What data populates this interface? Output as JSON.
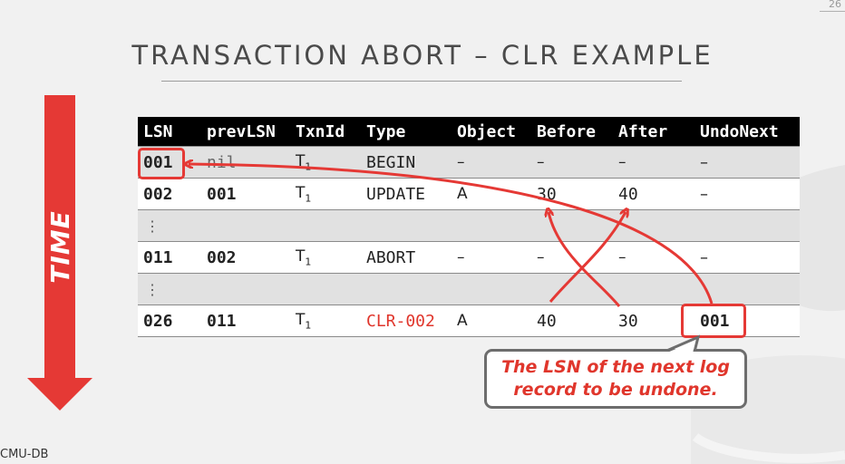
{
  "slide": {
    "number": "26",
    "title": "TRANSACTION ABORT – CLR EXAMPLE",
    "time_label": "TIME",
    "footer": "CMU-DB"
  },
  "table": {
    "headers": [
      "LSN",
      "prevLSN",
      "TxnId",
      "Type",
      "Object",
      "Before",
      "After",
      "UndoNext"
    ],
    "rows": [
      {
        "lsn": "001",
        "prev": "nil",
        "txn": "T",
        "txn_sub": "1",
        "type": "BEGIN",
        "object": "–",
        "before": "–",
        "after": "–",
        "undonext": "–"
      },
      {
        "lsn": "002",
        "prev": "001",
        "txn": "T",
        "txn_sub": "1",
        "type": "UPDATE",
        "object": "A",
        "before": "30",
        "after": "40",
        "undonext": "–"
      },
      {
        "lsn": "⋮"
      },
      {
        "lsn": "011",
        "prev": "002",
        "txn": "T",
        "txn_sub": "1",
        "type": "ABORT",
        "object": "–",
        "before": "–",
        "after": "–",
        "undonext": "–"
      },
      {
        "lsn": "⋮"
      },
      {
        "lsn": "026",
        "prev": "011",
        "txn": "T",
        "txn_sub": "1",
        "type": "CLR-002",
        "object": "A",
        "before": "40",
        "after": "30",
        "undonext": "001"
      }
    ]
  },
  "callout": "The LSN of the next log\nrecord to be undone.",
  "colors": {
    "accent": "#e53935",
    "header_bg": "#000000",
    "row_gray": "#e1e1e1"
  }
}
